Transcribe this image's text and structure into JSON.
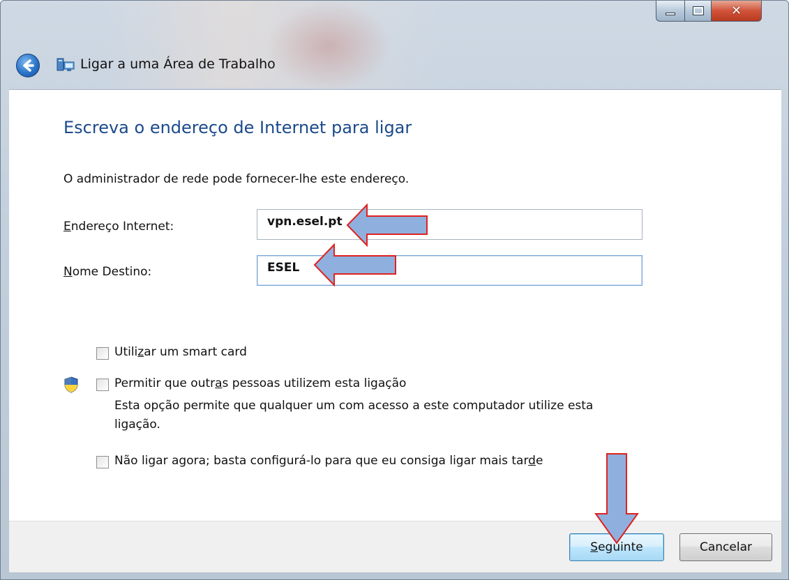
{
  "window": {
    "title": "Ligar a uma Área de Trabalho",
    "colors": {
      "heading": "#1b4a8a",
      "arrow_fill": "#8fb0de",
      "arrow_stroke": "#e0211f"
    }
  },
  "caption_buttons": {
    "minimize": "minimize",
    "maximize": "maximize",
    "close": "✕"
  },
  "content": {
    "heading": "Escreva o endereço de Internet para ligar",
    "subtitle": "O administrador de rede pode fornecer-lhe este endereço.",
    "address": {
      "label_first": "E",
      "label_rest": "ndereço Internet:",
      "value": "vpn.esel.pt"
    },
    "destination": {
      "label_first": "N",
      "label_rest": "ome Destino:",
      "value": "ESEL"
    },
    "options": {
      "smart_card": {
        "pre": "Utili",
        "accel": "z",
        "post": "ar um smart card",
        "checked": false
      },
      "allow_others": {
        "pre": "Permitir que outr",
        "accel": "a",
        "post": "s pessoas utilizem esta ligação",
        "note": "Esta opção permite que qualquer um com acesso a este computador utilize esta ligação.",
        "checked": false
      },
      "connect_later": {
        "pre": "Não ligar agora; basta configurá-lo para que eu consiga ligar mais tar",
        "accel": "d",
        "post": "e",
        "checked": false
      }
    }
  },
  "footer": {
    "next": {
      "accel": "S",
      "rest": "eguinte"
    },
    "cancel": "Cancelar"
  },
  "icons": [
    "back-arrow-icon",
    "network-icon",
    "uac-shield-icon",
    "annotation-arrow-icon"
  ]
}
